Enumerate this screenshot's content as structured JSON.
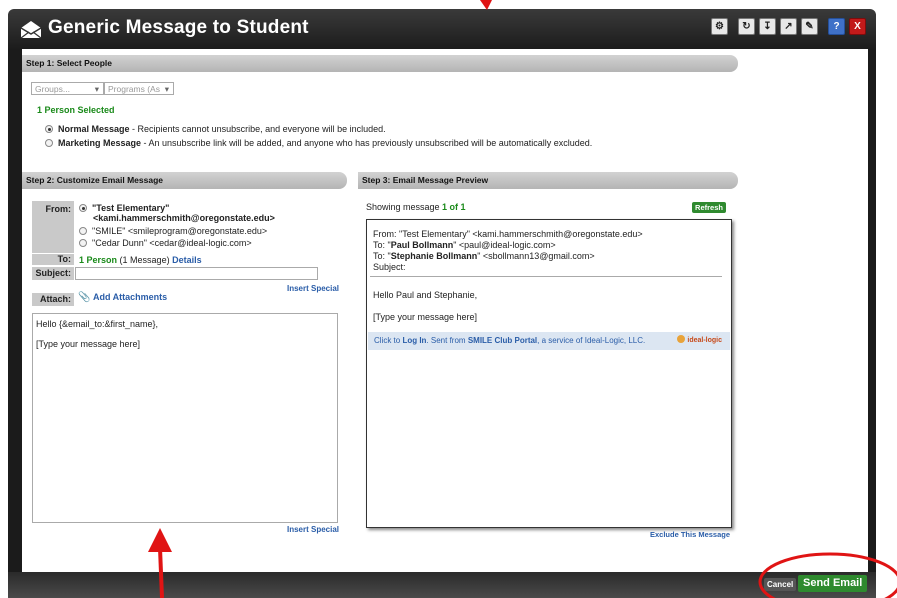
{
  "window": {
    "title": "Generic Message to Student"
  },
  "toolbar": {
    "tools": [
      "wrench-icon",
      "refresh-icon",
      "download-icon",
      "resize-icon",
      "edit-icon",
      "help-icon",
      "close-icon"
    ],
    "help_label": "?",
    "close_label": "X"
  },
  "step1": {
    "header": "Step 1: Select People",
    "groups_placeholder": "Groups...",
    "programs_placeholder": "Programs (As",
    "selected": "1 Person Selected",
    "normal_label": "Normal Message",
    "normal_desc": " - Recipients cannot unsubscribe, and everyone will be included.",
    "marketing_label": "Marketing Message",
    "marketing_desc": " - An unsubscribe link will be added, and anyone who has previously unsubscribed will be automatically excluded."
  },
  "step2": {
    "header": "Step 2: Customize Email Message",
    "from_label": "From:",
    "from_options": [
      {
        "name": "\"Test Elementary\"",
        "email": "<kami.hammerschmith@oregonstate.edu>"
      },
      {
        "text": "\"SMILE\" <smileprogram@oregonstate.edu>"
      },
      {
        "text": "\"Cedar Dunn\" <cedar@ideal-logic.com>"
      }
    ],
    "to_label": "To:",
    "to_count": "1 Person",
    "to_messages": "(1 Message)",
    "details_link": "Details",
    "subject_label": "Subject:",
    "insert_special_1": "Insert Special",
    "attach_label": "Attach:",
    "add_attachments": "Add Attachments",
    "body_line1": "Hello {&email_to:&first_name},",
    "body_line2": "[Type your message here]",
    "insert_special_2": "Insert Special"
  },
  "step3": {
    "header": "Step 3: Email Message Preview",
    "showing": "Showing message ",
    "showing_count": "1 of 1",
    "refresh": "Refresh",
    "from_line": "From: \"Test Elementary\" <kami.hammerschmith@oregonstate.edu>",
    "to_prefix_1": "To: \"",
    "to_name_1": "Paul Bollmann",
    "to_rest_1": "\" <paul@ideal-logic.com>",
    "to_prefix_2": "To: \"",
    "to_name_2": "Stephanie Bollmann",
    "to_rest_2": "\" <sbollmann13@gmail.com>",
    "subject_line": "Subject:",
    "greeting": "Hello Paul and Stephanie,",
    "body": "[Type your message here]",
    "portal_click": "Click to ",
    "portal_login": "Log In",
    "portal_sent": ". Sent from ",
    "portal_name": "SMILE Club Portal",
    "portal_service": ", a service of ",
    "portal_company": "Ideal-Logic, LLC.",
    "logo_text": "ideal-logic",
    "exclude": "Exclude This Message"
  },
  "footer": {
    "cancel": "Cancel",
    "send": "Send Email"
  }
}
